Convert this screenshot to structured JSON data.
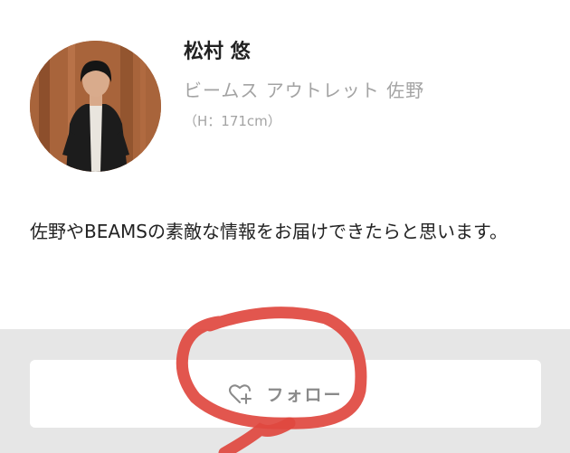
{
  "profile": {
    "name": "松村 悠",
    "shop": "ビームス アウトレット 佐野",
    "height": "（H：171cm）",
    "avatar_icon": "staff-photo"
  },
  "bio": "佐野やBEAMSの素敵な情報をお届けできたらと思います。",
  "follow": {
    "label": "フォロー",
    "icon": "heart-plus-icon"
  },
  "colors": {
    "name_text": "#222222",
    "muted_text": "#a3a3a3",
    "follow_area_bg": "#e6e6e6",
    "annotation_red": "#e0483f"
  }
}
